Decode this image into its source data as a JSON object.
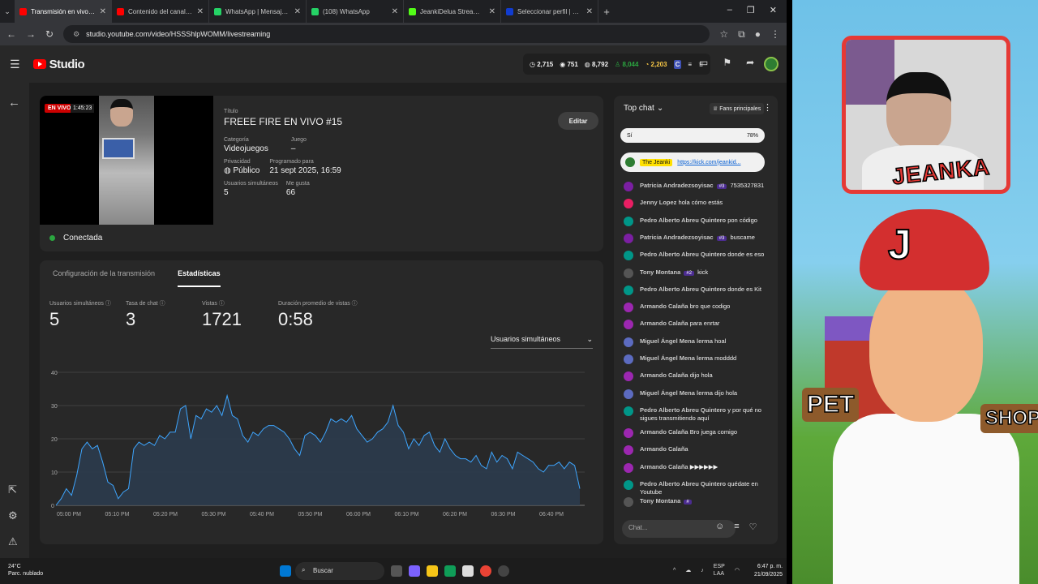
{
  "browser": {
    "tabs": [
      {
        "title": "Transmisión en vivo - YouTube",
        "color": "#ff0000",
        "active": true
      },
      {
        "title": "Contenido del canal - YouTube",
        "color": "#ff0000",
        "active": false
      },
      {
        "title": "WhatsApp | Mensajería y llama",
        "color": "#25d366",
        "active": false
      },
      {
        "title": "(108) WhatsApp",
        "color": "#25d366",
        "active": false
      },
      {
        "title": "JeankiDelua Stream - Watch",
        "color": "#53fc18",
        "active": false
      },
      {
        "title": "Seleccionar perfil | Disney+",
        "color": "#113ccf",
        "active": false
      }
    ],
    "url": "studio.youtube.com/video/HSSShlpWOMM/livestreaming"
  },
  "studio": {
    "logo_text": "Studio",
    "stats": [
      "2,715",
      "751",
      "8,792",
      "8,044",
      "2,203"
    ]
  },
  "stream": {
    "live_badge": "EN VIVO",
    "elapsed": "1:45:23",
    "title_label": "Título",
    "title": "FREEE FIRE EN VIVO #15",
    "category_label": "Categoría",
    "category": "Videojuegos",
    "game_label": "Juego",
    "game": "–",
    "privacy_label": "Privacidad",
    "privacy": "Público",
    "scheduled_label": "Programado para",
    "scheduled": "21 sept 2025, 16:59",
    "viewers_label": "Usuarios simultáneos",
    "viewers": "5",
    "likes_label": "Me gusta",
    "likes": "66",
    "edit_label": "Editar",
    "status": "Conectada"
  },
  "analytics": {
    "tabs": [
      "Configuración de la transmisión",
      "Estadísticas"
    ],
    "metrics": [
      {
        "label": "Usuarios simultáneos",
        "value": "5"
      },
      {
        "label": "Tasa de chat",
        "value": "3"
      },
      {
        "label": "Vistas",
        "value": "1721"
      },
      {
        "label": "Duración promedio de vistas",
        "value": "0:58"
      }
    ],
    "select_value": "Usuarios simultáneos"
  },
  "chart_data": {
    "type": "area",
    "ylim": [
      0,
      40
    ],
    "yticks": [
      0,
      10,
      20,
      30,
      40
    ],
    "xticks": [
      "05:00 PM",
      "05:10 PM",
      "05:20 PM",
      "05:30 PM",
      "05:40 PM",
      "05:50 PM",
      "06:00 PM",
      "06:10 PM",
      "06:20 PM",
      "06:30 PM",
      "06:40 PM"
    ],
    "values": [
      0,
      2,
      5,
      3,
      9,
      17,
      19,
      17,
      18,
      13,
      7,
      6,
      2,
      4,
      5,
      17,
      19,
      18,
      19,
      18,
      21,
      20,
      22,
      22,
      29,
      30,
      20,
      27,
      26,
      29,
      28,
      30,
      27,
      33,
      27,
      26,
      21,
      19,
      22,
      21,
      23,
      24,
      24,
      23,
      22,
      20,
      17,
      15,
      21,
      22,
      21,
      19,
      22,
      26,
      25,
      26,
      25,
      27,
      23,
      21,
      19,
      20,
      22,
      23,
      25,
      30,
      24,
      22,
      17,
      20,
      18,
      21,
      22,
      18,
      16,
      20,
      17,
      15,
      14,
      14,
      13,
      15,
      12,
      11,
      16,
      13,
      15,
      14,
      11,
      16,
      15,
      14,
      13,
      11,
      10,
      12,
      12,
      13,
      11,
      13,
      12,
      5
    ],
    "color": "#3ea6ff"
  },
  "chat": {
    "header": "Top chat",
    "fans_label": "Fans principales",
    "poll": {
      "option": "Sí",
      "percent": "78%"
    },
    "pinned": {
      "author": "The Jeanki",
      "text": "https://kick.com/jeankid..."
    },
    "messages": [
      {
        "author": "Patricia Andradezsoyisac",
        "badge": "#3",
        "text": "7535327831",
        "color": "#7b1fa2"
      },
      {
        "author": "Jenny Lopez",
        "badge": "",
        "text": "hola cómo estás",
        "color": "#e91e63"
      },
      {
        "author": "Pedro Alberto Abreu Quintero",
        "badge": "",
        "text": "pon código",
        "color": "#009688"
      },
      {
        "author": "Patricia Andradezsoyisac",
        "badge": "#3",
        "text": "buscame",
        "color": "#7b1fa2"
      },
      {
        "author": "Pedro Alberto Abreu Quintero",
        "badge": "",
        "text": "donde es eso",
        "color": "#009688"
      },
      {
        "author": "Tony Montana",
        "badge": "#2",
        "text": "kick",
        "color": "#555555"
      },
      {
        "author": "Pedro Alberto Abreu Quintero",
        "badge": "",
        "text": "donde es Kit",
        "color": "#009688"
      },
      {
        "author": "Armando Calaña",
        "badge": "",
        "text": "bro que codigo",
        "color": "#9c27b0"
      },
      {
        "author": "Armando Calaña",
        "badge": "",
        "text": "para enrtar",
        "color": "#9c27b0"
      },
      {
        "author": "Miguel Ángel Mena lerma",
        "badge": "",
        "text": "hoal",
        "color": "#5c6bc0"
      },
      {
        "author": "Miguel Ángel Mena lerma",
        "badge": "",
        "text": "modddd",
        "color": "#5c6bc0"
      },
      {
        "author": "Armando Calaña",
        "badge": "",
        "text": "dijo hola",
        "color": "#9c27b0"
      },
      {
        "author": "Miguel Ángel Mena lerma",
        "badge": "",
        "text": "dijo hola",
        "color": "#5c6bc0"
      },
      {
        "author": "Pedro Alberto Abreu Quintero",
        "badge": "",
        "text": "y por qué no sigues transmitiendo aquí",
        "color": "#009688"
      },
      {
        "author": "Armando Calaña",
        "badge": "",
        "text": "Bro juega comigo",
        "color": "#9c27b0"
      },
      {
        "author": "Armando Calaña",
        "badge": "",
        "text": "",
        "color": "#9c27b0"
      },
      {
        "author": "Armando Calaña",
        "badge": "",
        "text": "▶▶▶▶▶▶",
        "color": "#9c27b0"
      },
      {
        "author": "Pedro Alberto Abreu Quintero",
        "badge": "",
        "text": "quédate en Youtube",
        "color": "#009688"
      },
      {
        "author": "Tony Montana",
        "badge": "#",
        "text": "",
        "color": "#555555"
      }
    ],
    "input_placeholder": "Chat..."
  },
  "taskbar": {
    "temp": "24°C",
    "weather": "Parc. nublado",
    "search": "Buscar",
    "lang1": "ESP",
    "lang2": "LAA",
    "time": "6:47 p. m.",
    "date": "21/09/2025"
  },
  "overlay": {
    "streamer_name": "JEANKA",
    "sign_left": "PET",
    "sign_right": "SHOP",
    "cap_letter": "J"
  }
}
